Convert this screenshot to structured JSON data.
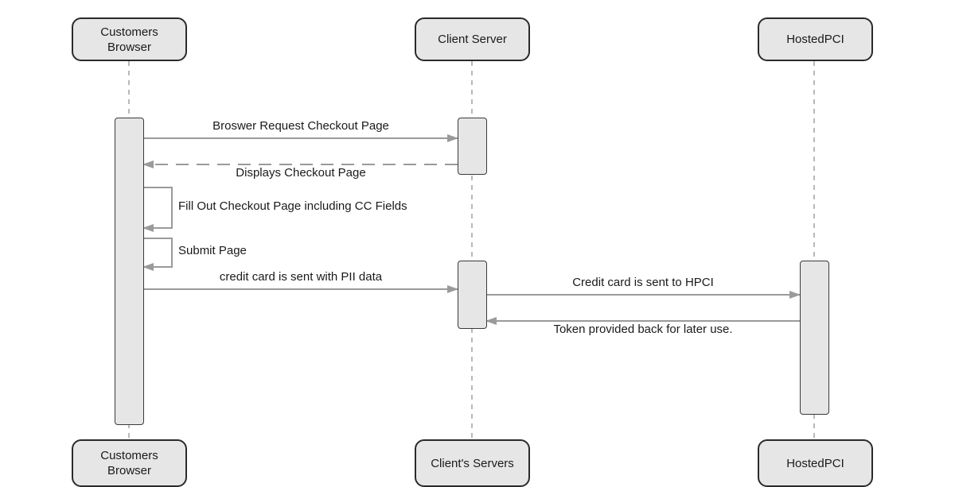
{
  "participants_top": [
    {
      "id": "browser",
      "label": "Customers\nBrowser"
    },
    {
      "id": "client",
      "label": "Client Server"
    },
    {
      "id": "hpci",
      "label": "HostedPCI"
    }
  ],
  "participants_bottom": [
    {
      "id": "browser",
      "label": "Customers\nBrowser"
    },
    {
      "id": "client",
      "label": "Client's Servers"
    },
    {
      "id": "hpci",
      "label": "HostedPCI"
    }
  ],
  "messages": [
    {
      "from": "browser",
      "to": "client",
      "style": "solid",
      "label": "Broswer Request Checkout Page"
    },
    {
      "from": "client",
      "to": "browser",
      "style": "dashed",
      "label": "Displays Checkout Page"
    },
    {
      "from": "browser",
      "to": "browser",
      "style": "self",
      "label": "Fill Out Checkout Page including CC Fields"
    },
    {
      "from": "browser",
      "to": "browser",
      "style": "self",
      "label": "Submit Page"
    },
    {
      "from": "browser",
      "to": "client",
      "style": "solid",
      "label": "credit card is  sent with PII data"
    },
    {
      "from": "client",
      "to": "hpci",
      "style": "solid",
      "label": "Credit card is sent to HPCI"
    },
    {
      "from": "hpci",
      "to": "client",
      "style": "solid",
      "label": "Token provided back for later use."
    }
  ],
  "colors": {
    "box_fill": "#e6e6e6",
    "box_stroke": "#2a2a2a",
    "arrow": "#9a9a9a",
    "lifeline": "#8a8a8a"
  }
}
